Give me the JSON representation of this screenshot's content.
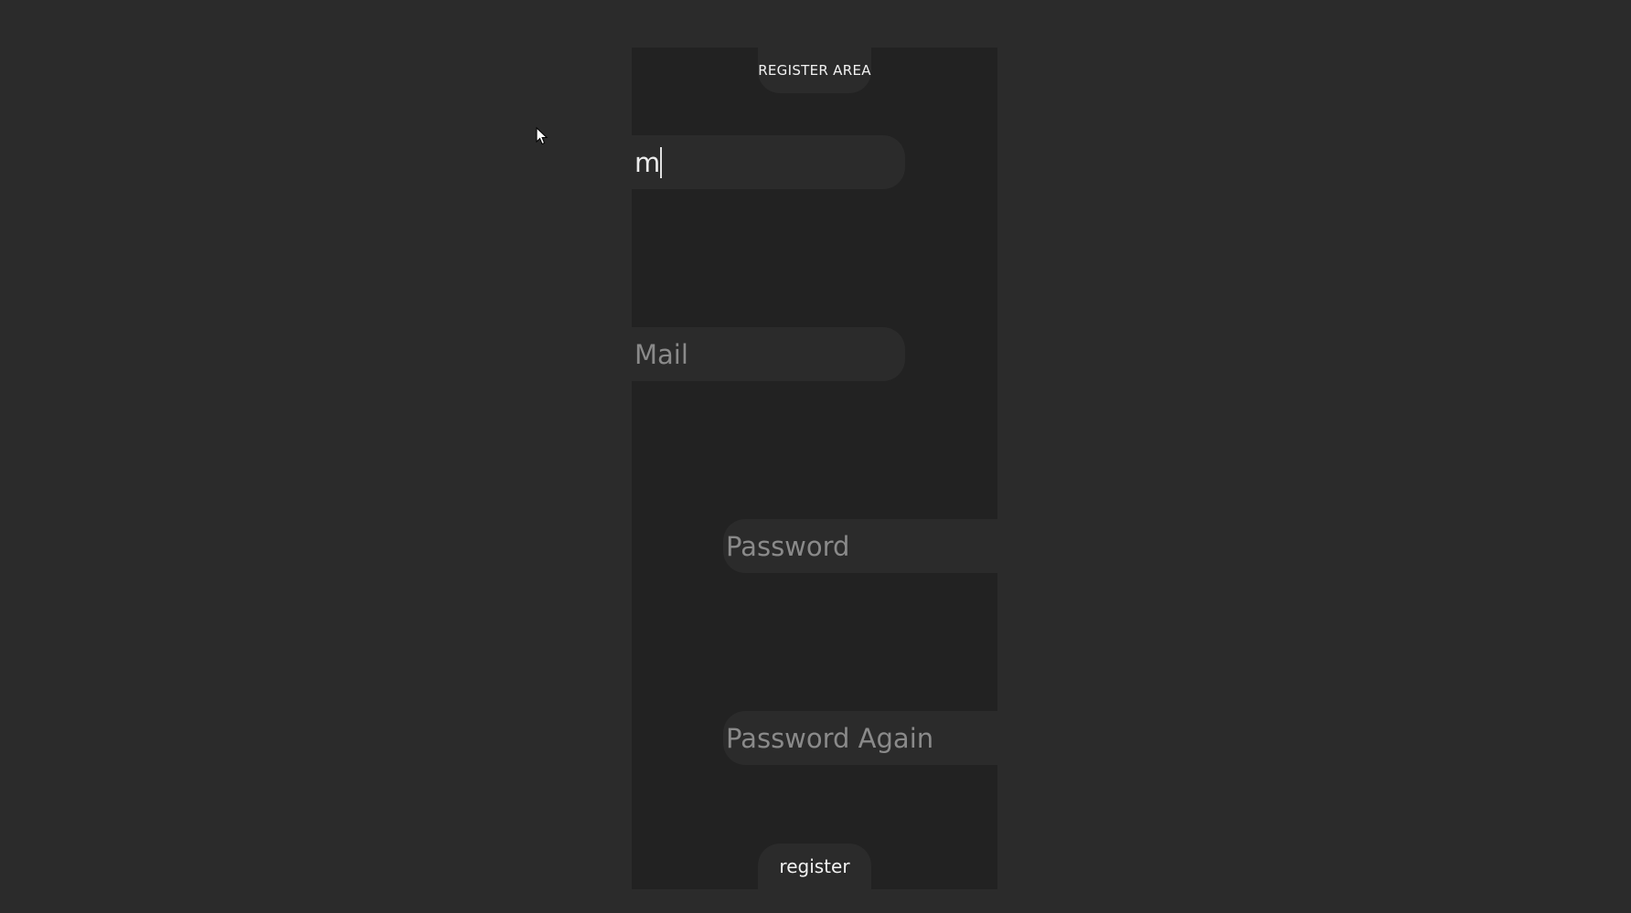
{
  "form": {
    "title": "REGISTER AREA",
    "username": {
      "value": "m",
      "placeholder": ""
    },
    "mail": {
      "value": "",
      "placeholder": "Mail"
    },
    "password": {
      "value": "",
      "placeholder": "Password"
    },
    "password_again": {
      "value": "",
      "placeholder": "Password Again"
    },
    "submit_label": "register"
  },
  "colors": {
    "page_background": "#2b2b2b",
    "panel_background": "#222222",
    "text": "#f2f2f2",
    "placeholder": "#8a8a8a"
  },
  "icons": {
    "mouse_cursor": "arrow-cursor-icon"
  }
}
